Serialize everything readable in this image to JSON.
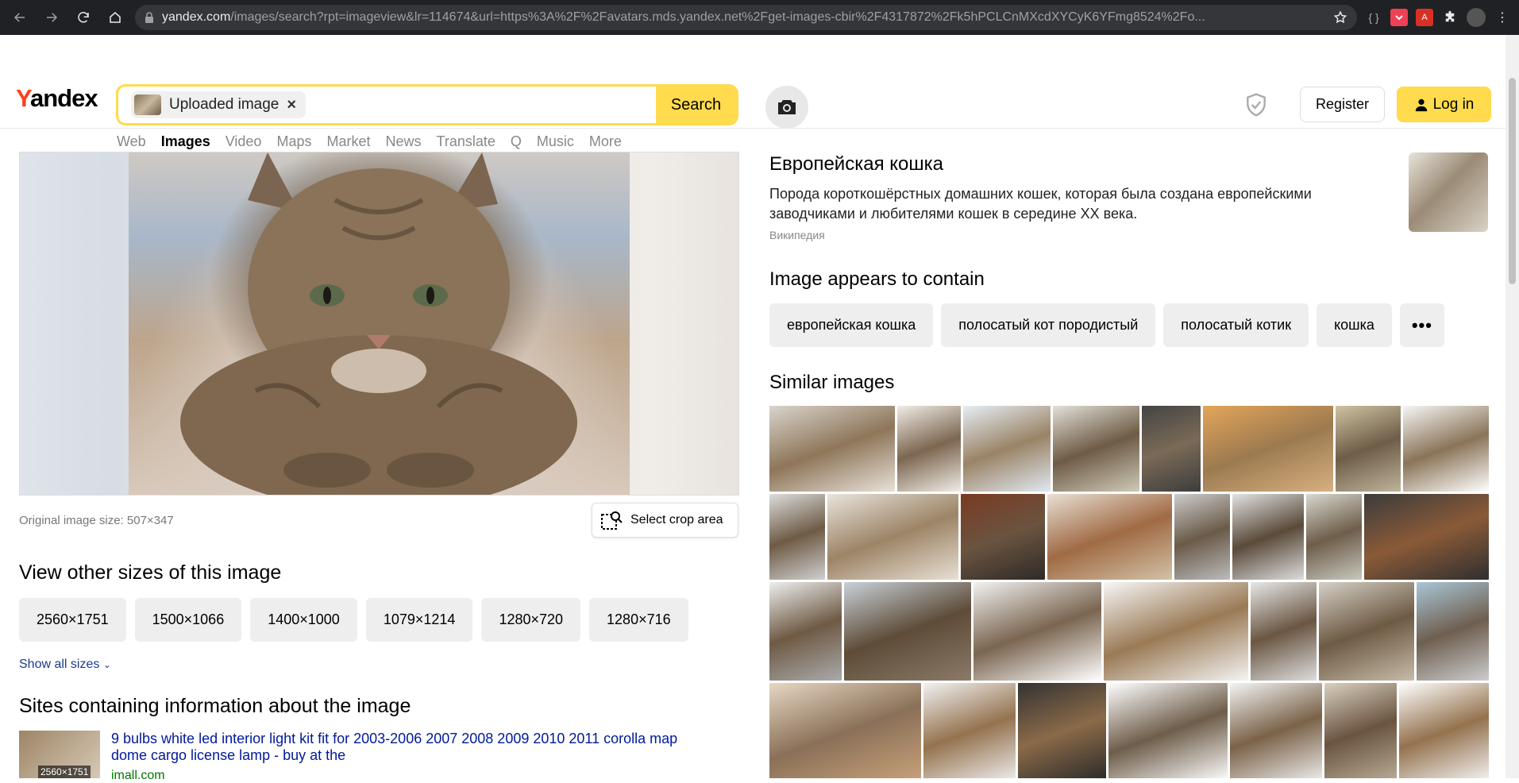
{
  "browser": {
    "url_host": "yandex.com",
    "url_path": "/images/search?rpt=imageview&lr=114674&url=https%3A%2F%2Favatars.mds.yandex.net%2Fget-images-cbir%2F4317872%2Fk5hPCLCnMXcdXYCyK6YFmg8524%2Fo..."
  },
  "header": {
    "logo": "Yandex",
    "chip_label": "Uploaded image",
    "chip_close": "×",
    "search_label": "Search",
    "register_label": "Register",
    "login_label": "Log in",
    "tabs": [
      "Web",
      "Images",
      "Video",
      "Maps",
      "Market",
      "News",
      "Translate",
      "Q",
      "Music",
      "More"
    ],
    "active_tab": "Images"
  },
  "preview": {
    "original_size": "Original image size: 507×347",
    "crop_label": "Select crop area"
  },
  "sizes": {
    "heading": "View other sizes of this image",
    "items": [
      "2560×1751",
      "1500×1066",
      "1400×1000",
      "1079×1214",
      "1280×720",
      "1280×716"
    ],
    "show_all": "Show all sizes"
  },
  "sites": {
    "heading": "Sites containing information about the image",
    "thumb_badge": "2560×1751",
    "title": "9 bulbs white led interior light kit fit for 2003-2006 2007 2008 2009 2010 2011 corolla map dome cargo license lamp - buy at the",
    "host": "imall.com"
  },
  "wiki": {
    "title": "Европейская кошка",
    "description": "Порода короткошёрстных домашних кошек, которая была создана европейскими заводчиками и любителями кошек в середине XX века.",
    "source": "Википедия"
  },
  "contains": {
    "heading": "Image appears to contain",
    "tags": [
      "европейская кошка",
      "полосатый кот породистый",
      "полосатый котик",
      "кошка"
    ],
    "more": "•••"
  },
  "similar": {
    "heading": "Similar images"
  },
  "colors": {
    "accent": "#ffdb4d",
    "logo_red": "#fc3f1d",
    "link_blue": "#1a3a8f"
  }
}
